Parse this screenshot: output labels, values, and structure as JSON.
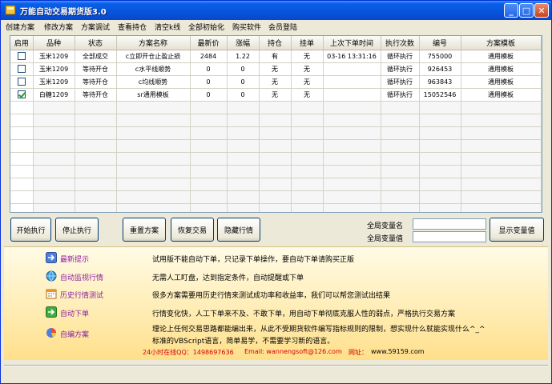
{
  "window": {
    "title": "万能自动交易期货版3.0"
  },
  "menu": [
    "创建方案",
    "修改方案",
    "方案调试",
    "查看持仓",
    "清空k线",
    "全部初始化",
    "购买软件",
    "会员登陆"
  ],
  "grid": {
    "columns": [
      "启用",
      "品种",
      "状态",
      "方案名称",
      "最新价",
      "涨幅",
      "持仓",
      "挂单",
      "上次下单时间",
      "执行次数",
      "编号",
      "方案模板"
    ],
    "rows": [
      {
        "enabled": false,
        "cells": [
          "",
          "玉米1209",
          "全部成交",
          "c立即开仓止盈止损",
          "2484",
          "1.22",
          "有",
          "无",
          "03-16 13:31:16",
          "循环执行",
          "755000",
          "通用模板"
        ]
      },
      {
        "enabled": false,
        "cells": [
          "",
          "玉米1209",
          "等待开仓",
          "c水平线顺势",
          "0",
          "0",
          "无",
          "无",
          "",
          "循环执行",
          "926453",
          "通用模板"
        ]
      },
      {
        "enabled": false,
        "cells": [
          "",
          "玉米1209",
          "等待开仓",
          "c均线顺势",
          "0",
          "0",
          "无",
          "无",
          "",
          "循环执行",
          "963843",
          "通用模板"
        ]
      },
      {
        "enabled": true,
        "cells": [
          "",
          "白糖1209",
          "等待开仓",
          "sr通用模板",
          "0",
          "0",
          "无",
          "无",
          "",
          "循环执行",
          "15052546",
          "通用模板"
        ]
      }
    ]
  },
  "buttons": {
    "start": "开始执行",
    "stop": "停止执行",
    "reset": "重置方案",
    "restore": "恢复交易",
    "hide": "隐藏行情",
    "show_vars": "显示变量值"
  },
  "globals": {
    "name_label": "全局变量名",
    "value_label": "全局变量值"
  },
  "tips": [
    {
      "icon": "arrow-icon",
      "label": "最新提示",
      "text": "试用版不能自动下单，只记录下单操作，要自动下单请购买正版"
    },
    {
      "icon": "globe-icon",
      "label": "自动监视行情",
      "text": "无需人工盯盘，达到指定条件，自动提醒或下单"
    },
    {
      "icon": "calendar-icon",
      "label": "历史行情测试",
      "text": "很多方案需要用历史行情来测试成功率和收益率，我们可以帮您测试出结果"
    },
    {
      "icon": "arrow-icon",
      "label": "自动下单",
      "text": "行情变化快，人工下单来不及、不敢下单，用自动下单彻底克服人性的弱点，严格执行交易方案"
    },
    {
      "icon": "pie-icon",
      "label": "自编方案",
      "text": "理论上任何交易思路都能编出来，从此不受期货软件编写指标规则的限制，想实现什么就能实现什么^_^",
      "text2": "标准的VBScript语言，简单易学，不需要学习新的语言。"
    }
  ],
  "contact": {
    "qq": "24小时在线QQ：1498697636",
    "email": "Email: wannengsoft@126.com",
    "site_label": "网址：",
    "site": "www.59159.com"
  },
  "colors": {
    "accent": "#0754dc",
    "tip_label": "#8a1fa0",
    "contact_red": "#d00000"
  }
}
